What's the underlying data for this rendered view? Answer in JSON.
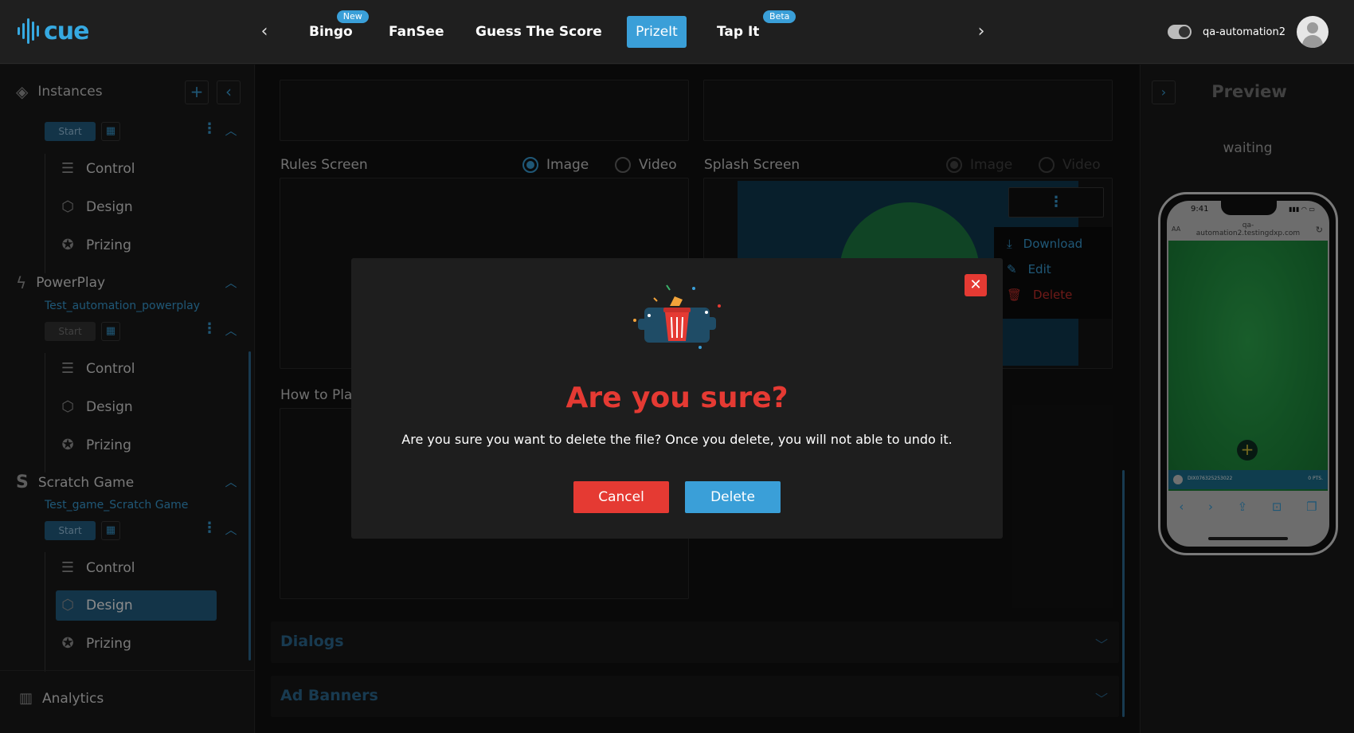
{
  "app": {
    "logo_text": "cue"
  },
  "header": {
    "tabs": [
      {
        "label": "Bingo",
        "badge": "New"
      },
      {
        "label": "FanSee",
        "badge": ""
      },
      {
        "label": "Guess The Score",
        "badge": ""
      },
      {
        "label": "PrizeIt",
        "badge": ""
      },
      {
        "label": "Tap It",
        "badge": "Beta"
      }
    ],
    "active_tab": "PrizeIt",
    "username": "qa-automation2"
  },
  "sidebar": {
    "title": "Instances",
    "start_label": "Start",
    "menu_labels": {
      "control": "Control",
      "design": "Design",
      "prizing": "Prizing"
    },
    "sections": [
      {
        "title": "PowerPlay",
        "subtitle": "Test_automation_powerplay"
      },
      {
        "title": "Scratch Game",
        "subtitle": "Test_game_Scratch Game"
      }
    ],
    "active_item": "Scratch Game / Design",
    "analytics_label": "Analytics"
  },
  "main": {
    "rules_screen": {
      "label": "Rules Screen",
      "options": [
        "Image",
        "Video"
      ],
      "selected": "Image"
    },
    "splash_screen": {
      "label": "Splash Screen",
      "options": [
        "Image",
        "Video"
      ],
      "selected": "Image"
    },
    "how_to_play": {
      "label": "How to Play"
    },
    "context_menu": {
      "download": "Download",
      "edit": "Edit",
      "delete": "Delete"
    },
    "accordions": [
      "Dialogs",
      "Ad Banners"
    ]
  },
  "preview": {
    "title": "Preview",
    "status": "waiting",
    "phone": {
      "time": "9:41",
      "aa": "AA",
      "url_line1": "qa-",
      "url_line2": "automation2.testingdxp.com",
      "user_id": "DIX076325253022",
      "points": "0 PTS."
    }
  },
  "modal": {
    "title": "Are you sure?",
    "message": "Are you sure you want to delete the file? Once you delete, you will not able to undo it.",
    "cancel_label": "Cancel",
    "delete_label": "Delete"
  },
  "colors": {
    "accent": "#3a9fd8",
    "danger": "#e53a33",
    "background": "#141414",
    "active_nav": "#235f84"
  },
  "icons": {
    "prev": "chevron-left-icon",
    "next": "chevron-right-icon",
    "instances": "layers-icon",
    "add": "plus-icon",
    "collapse": "chevron-left-icon",
    "control": "sliders-icon",
    "design": "cube-icon",
    "prizing": "award-icon",
    "powerplay": "bolt-icon",
    "scratch": "scratch-s-icon",
    "analytics": "bar-chart-icon",
    "close": "close-icon",
    "illustration": "trash-bin-illustration"
  }
}
